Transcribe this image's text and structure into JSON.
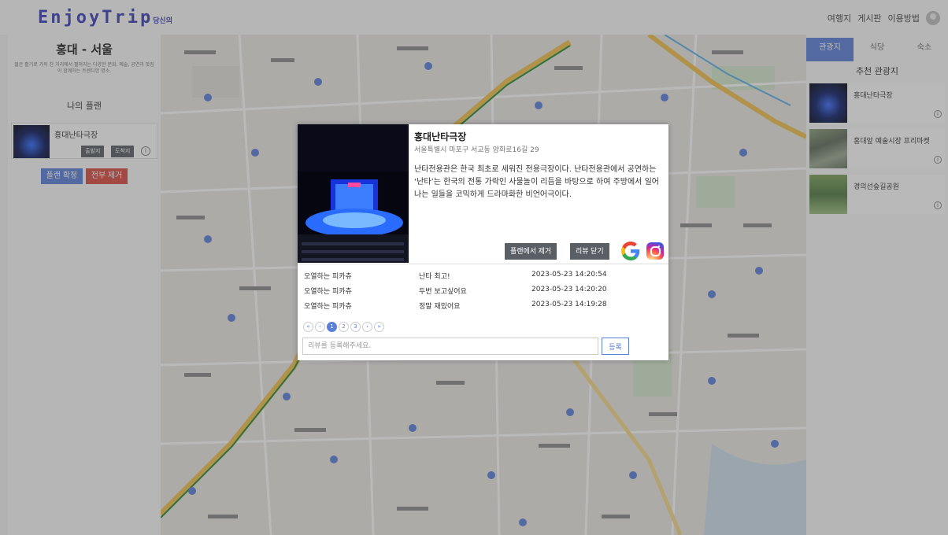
{
  "header": {
    "logo": "EnjoyTrip",
    "logo_sub": "당신의",
    "nav": [
      "여행지",
      "게시판",
      "이용방법"
    ]
  },
  "left_panel": {
    "region_title": "홍대 - 서울",
    "region_desc": "젊은 활기로 가득 찬 거리에서 펼쳐지는 다양한 문화, 예술, 공연과 맛집이 함께하는 트렌디한 명소.",
    "my_plan_title": "나의 플랜",
    "plan_item": {
      "name": "홍대난타극장",
      "btn_start": "출발지",
      "btn_end": "도착지"
    },
    "confirm_btn": "플랜 확정",
    "remove_all_btn": "전부 제거"
  },
  "right_panel": {
    "tabs": [
      "관광지",
      "식당",
      "숙소"
    ],
    "active_tab": 0,
    "rec_title": "추천 관광지",
    "spots": [
      "홍대난타극장",
      "홍대앞 예술시장 프리마켓",
      "경의선숲길공원"
    ]
  },
  "modal": {
    "title": "홍대난타극장",
    "address": "서울특별시 마포구 서교동 양화로16길 29",
    "description": "난타전용관은 한국 최초로 세워진 전용극장이다. 난타전용관에서 공연하는 ‘난타’는 한국의 전통 가락인 사물놀이 리듬을 바탕으로 하여 주방에서 일어나는 일들을 코믹하게 드라마화한 비언어극이다.",
    "remove_btn": "플랜에서 제거",
    "close_reviews_btn": "리뷰 닫기",
    "reviews": [
      {
        "author": "오열하는 피카츄",
        "content": "난타 최고!",
        "date": "2023-05-23 14:20:54"
      },
      {
        "author": "오열하는 피카츄",
        "content": "두번 보고싶어요",
        "date": "2023-05-23 14:20:20"
      },
      {
        "author": "오열하는 피카츄",
        "content": "정말 재밌어요",
        "date": "2023-05-23 14:19:28"
      }
    ],
    "pagination": [
      "«",
      "‹",
      "1",
      "2",
      "3",
      "›",
      "»"
    ],
    "current_page": "1",
    "review_placeholder": "리뷰를 등록해주세요.",
    "submit_btn": "등록"
  },
  "colors": {
    "accent": "#5b7fd8",
    "danger": "#d84b3f",
    "logo": "#3a3fb5"
  }
}
